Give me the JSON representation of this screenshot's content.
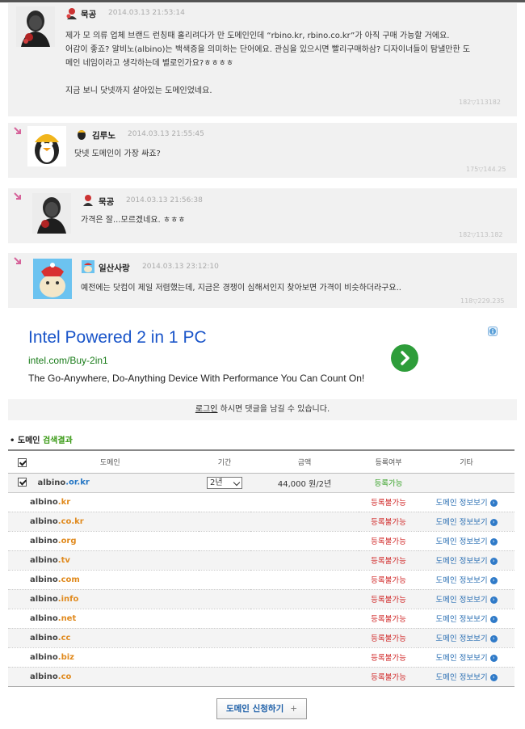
{
  "comments": [
    {
      "author": "묵공",
      "date": "2014.03.13 21:53:14",
      "lines": [
        "제가 모 의류 업체 브랜드 런칭때 홀리려다가 만 도메인인데 “rbino.kr, rbino.co.kr”가 아직 구매 가능할 거에요.",
        "어감이 좋죠? 알비노(albino)는 백색증을 의미하는 단어에요.  관심을 있으시면 빨리구매하삼? 디자이너들이 탐낼만한 도",
        "메인 네임이라고 생각하는데 별로인가요?ㅎㅎㅎㅎ",
        "",
        "지금 보니 닷넷까지 살아있는 도메인었네요."
      ],
      "votes": "182▽113182"
    },
    {
      "author": "김루노",
      "date": "2014.03.13 21:55:45",
      "lines": [
        "닷넷 도메인이 가장 싸죠?"
      ],
      "votes": "175▽144.25"
    },
    {
      "author": "묵공",
      "date": "2014.03.13 21:56:38",
      "lines": [
        "가격은 잘...모르겠네요. ㅎㅎㅎ"
      ],
      "votes": "182▽113.182"
    },
    {
      "author": "일산사랑",
      "date": "2014.03.13 23:12:10",
      "lines": [
        "예전에는 닷컴이 제일 저렴했는데, 지금은 경쟁이 심해서인지 찾아보면 가격이 비슷하더라구요.."
      ],
      "votes": "118▽229.235"
    }
  ],
  "ad": {
    "title": "Intel Powered 2 in 1 PC",
    "url": "intel.com/Buy-2in1",
    "desc": "The Go-Anywhere, Do-Anything Device With Performance You Can Count On!",
    "info_icon": "i"
  },
  "login_bar": {
    "link": "로그인",
    "text": " 하시면 댓글을 남길 수 있습니다."
  },
  "domain_section": {
    "title_prefix": "• 도메인 ",
    "title_highlight": "검색결과",
    "headers": [
      "도메인",
      "기간",
      "금액",
      "등록여부",
      "기타"
    ],
    "first": {
      "name": "albino",
      "tld": ".or.kr",
      "period": "2년",
      "price": "44,000 원/2년",
      "status": "등록가능"
    },
    "rows": [
      {
        "name": "albino",
        "tld": ".kr",
        "status": "등록불가능",
        "info": "도메인 정보보기"
      },
      {
        "name": "albino",
        "tld": ".co.kr",
        "status": "등록불가능",
        "info": "도메인 정보보기"
      },
      {
        "name": "albino",
        "tld": ".org",
        "status": "등록불가능",
        "info": "도메인 정보보기"
      },
      {
        "name": "albino",
        "tld": ".tv",
        "status": "등록불가능",
        "info": "도메인 정보보기"
      },
      {
        "name": "albino",
        "tld": ".com",
        "status": "등록불가능",
        "info": "도메인 정보보기"
      },
      {
        "name": "albino",
        "tld": ".info",
        "status": "등록불가능",
        "info": "도메인 정보보기"
      },
      {
        "name": "albino",
        "tld": ".net",
        "status": "등록불가능",
        "info": "도메인 정보보기"
      },
      {
        "name": "albino",
        "tld": ".cc",
        "status": "등록불가능",
        "info": "도메인 정보보기"
      },
      {
        "name": "albino",
        "tld": ".biz",
        "status": "등록불가능",
        "info": "도메인 정보보기"
      },
      {
        "name": "albino",
        "tld": ".co",
        "status": "등록불가능",
        "info": "도메인 정보보기"
      }
    ],
    "button": "도메인 신청하기",
    "button_plus": "+"
  },
  "colors": {
    "ok": "#3aa32a",
    "no": "#d12b2b",
    "link": "#2b6fb3",
    "tld": "#e08a1e",
    "tld_first": "#2476c4"
  }
}
